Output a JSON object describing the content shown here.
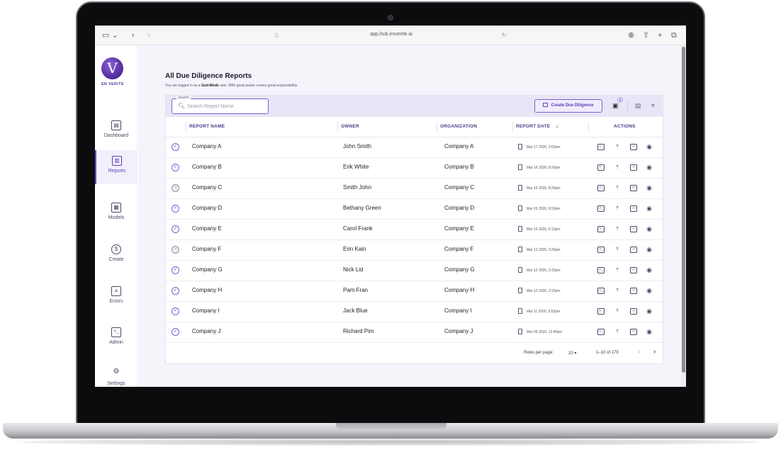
{
  "browser": {
    "url": "app.hub.enverite.ai"
  },
  "brand": {
    "logo_letter": "V",
    "name": "EN VERITE",
    "accent_color": "#6e49c8"
  },
  "sidebar": {
    "items": [
      {
        "label": "Dashboard",
        "icon": "dashboard-icon",
        "glyph": "▤",
        "active": false
      },
      {
        "label": "Reports",
        "icon": "bar-chart-icon",
        "glyph": "▥",
        "active": true
      },
      {
        "label": "Models",
        "icon": "grid-icon",
        "glyph": "▦",
        "active": false
      },
      {
        "label": "Create",
        "icon": "dollar-refresh-icon",
        "glyph": "$",
        "active": false
      },
      {
        "label": "Errors",
        "icon": "clipboard-icon",
        "glyph": "≡",
        "active": false
      },
      {
        "label": "Admin",
        "icon": "terminal-icon",
        "glyph": ">_",
        "active": false
      },
      {
        "label": "Settings",
        "icon": "gear-icon",
        "glyph": "⚙",
        "active": false
      }
    ]
  },
  "page": {
    "title": "All Due Diligence Reports",
    "subtitle_pre": "You are logged in as a ",
    "subtitle_mode": "God-Mode",
    "subtitle_post": " user. With great power comes great responsibility."
  },
  "toolbar": {
    "search_label": "Search",
    "search_placeholder": "Search Report Name",
    "create_label": "Create Due Diligence",
    "queue_count": "9"
  },
  "table": {
    "headers": {
      "report_name": "REPORT NAME",
      "owner": "OWNER",
      "organization": "ORGANIZATION",
      "report_date": "REPORT DATE",
      "actions": "ACTIONS"
    },
    "sort_indicator": "↓",
    "rows": [
      {
        "status": "complete",
        "name": "Company A",
        "owner": "John Smith",
        "organization": "Company A",
        "date": "Mar 17 2026, 2:03am"
      },
      {
        "status": "complete",
        "name": "Company B",
        "owner": "Erik White",
        "organization": "Company B",
        "date": "Mar 16 2026, 8:26pm"
      },
      {
        "status": "pending",
        "name": "Company C",
        "owner": "Smith John",
        "organization": "Company C",
        "date": "Mar 16 2026, 8:20pm"
      },
      {
        "status": "complete",
        "name": "Company D",
        "owner": "Bethany Green",
        "organization": "Company D",
        "date": "Mar 16 2026, 6:59pm"
      },
      {
        "status": "complete",
        "name": "Company E",
        "owner": "Carol Frank",
        "organization": "Company E",
        "date": "Mar 16 2026, 6:13pm"
      },
      {
        "status": "pending",
        "name": "Company F",
        "owner": "Erin Kain",
        "organization": "Company F",
        "date": "Mar 13 2026, 3:29pm"
      },
      {
        "status": "complete",
        "name": "Company G",
        "owner": "Nick Lid",
        "organization": "Company G",
        "date": "Mar 12 2026, 3:15pm"
      },
      {
        "status": "complete",
        "name": "Company H",
        "owner": "Pam Fran",
        "organization": "Company H",
        "date": "Mar 12 2026, 3:15pm"
      },
      {
        "status": "complete",
        "name": "Company I",
        "owner": "Jack Blue",
        "organization": "Company I",
        "date": "Mar 11 2026, 3:53pm"
      },
      {
        "status": "complete",
        "name": "Company J",
        "owner": "Richard Pim",
        "organization": "Company J",
        "date": "Mar 06 2026, 12:40pm"
      }
    ]
  },
  "pagination": {
    "rows_label": "Rows per page:",
    "rows_value": "10",
    "range": "1–10 of 179"
  }
}
